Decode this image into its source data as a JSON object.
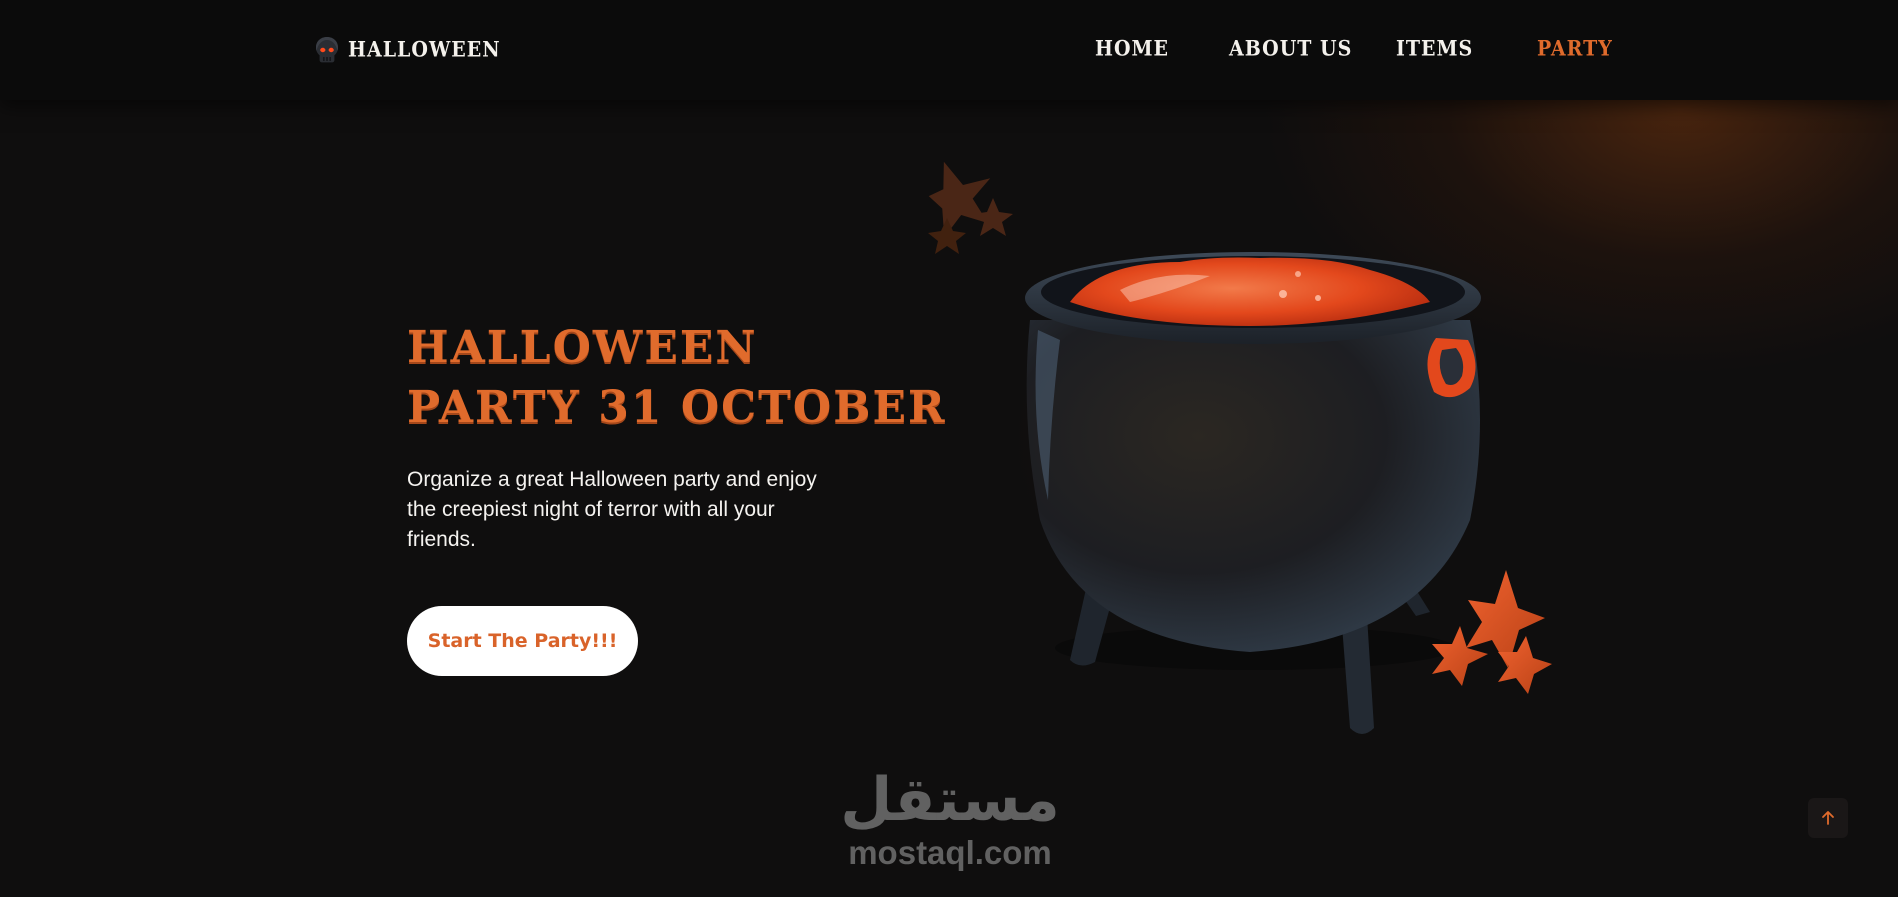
{
  "brand": {
    "name": "HALLOWEEN",
    "logo_icon": "skull-icon"
  },
  "nav": {
    "items": [
      {
        "label": "HOME",
        "active": false
      },
      {
        "label": "ABOUT US",
        "active": false
      },
      {
        "label": "ITEMS",
        "active": false
      },
      {
        "label": "PARTY",
        "active": true
      }
    ]
  },
  "hero": {
    "title_line1": "HALLOWEEN",
    "title_line2": "PARTY 31 OCTOBER",
    "description": "Organize a great Halloween party and enjoy the creepiest night of terror with all your friends.",
    "cta_label": "Start The Party!!!"
  },
  "decorations": {
    "main_image": "cauldron-illustration",
    "star_icons": "star-icon"
  },
  "watermark": {
    "arabic": "مستقل",
    "latin": "mostaql.com"
  },
  "scroll_top": {
    "icon": "arrow-up-icon"
  },
  "colors": {
    "accent": "#e06b2c",
    "background": "#0f0e0e",
    "header": "#0b0b0b",
    "text": "#f4f1ec",
    "button_bg": "#ffffff"
  }
}
